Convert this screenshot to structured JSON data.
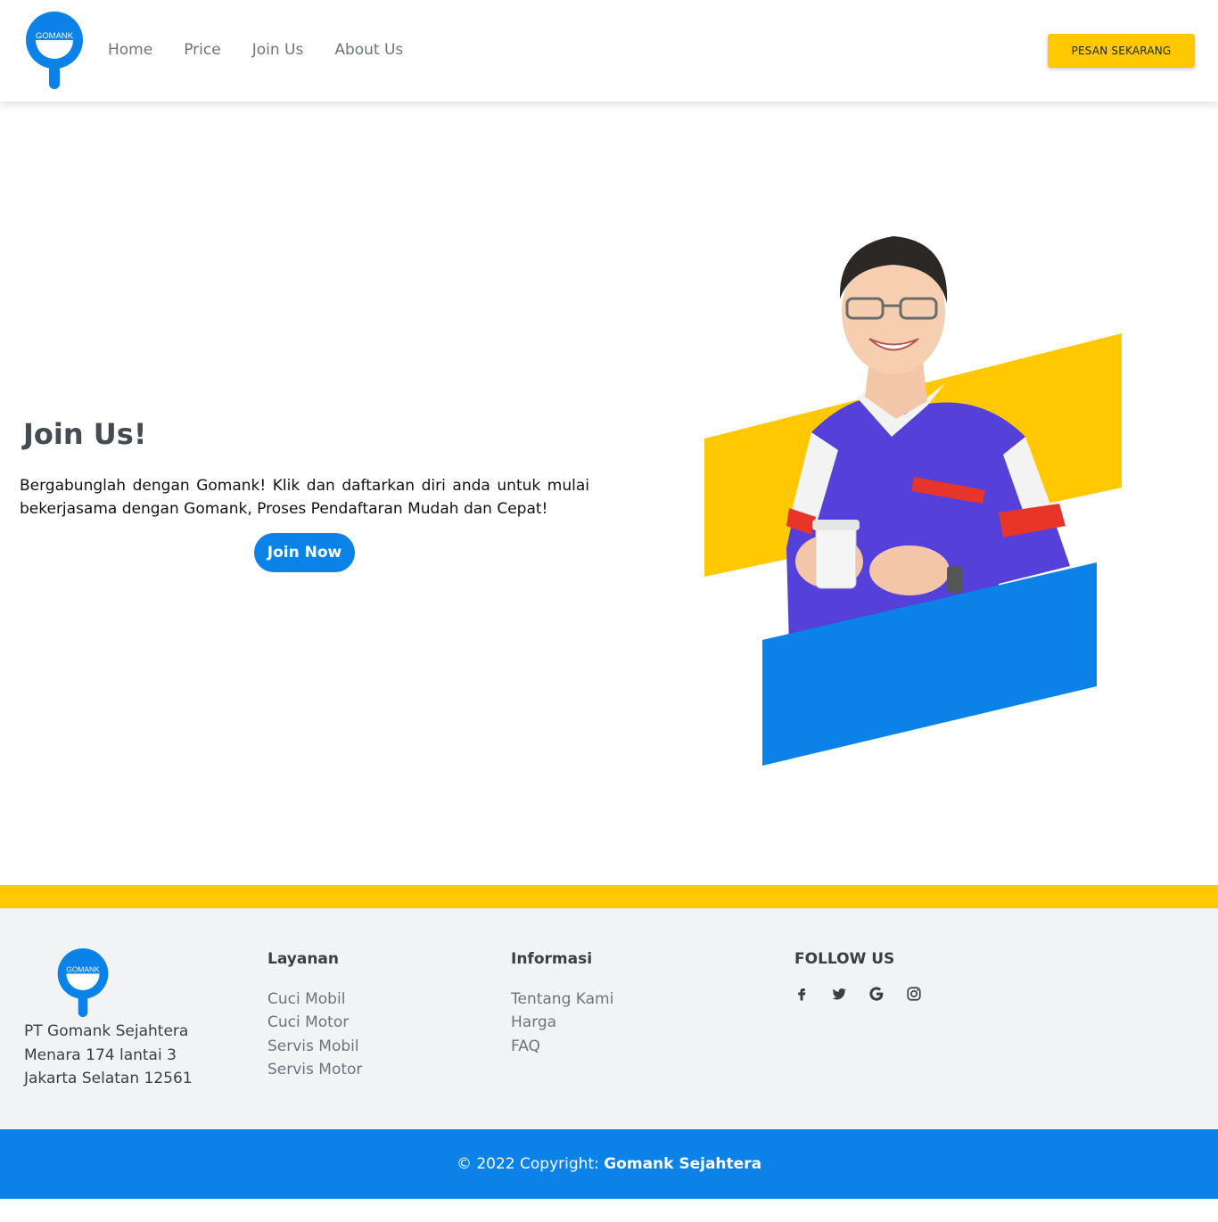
{
  "brand": {
    "logo_text": "GOMANK",
    "primary_color": "#0a82e8",
    "accent_color": "#ffc800"
  },
  "nav": {
    "links": [
      "Home",
      "Price",
      "Join Us",
      "About Us"
    ],
    "cta_label": "PESAN SEKARANG"
  },
  "hero": {
    "title": "Join Us!",
    "description": "Bergabunglah dengan Gomank! Klik dan daftarkan diri anda untuk mulai bekerjasama dengan Gomank, Proses Pendaftaran Mudah dan Cepat!",
    "button_label": "Join Now"
  },
  "footer": {
    "address_lines": [
      "PT Gomank Sejahtera",
      "Menara 174 lantai 3",
      "Jakarta Selatan 12561"
    ],
    "services": {
      "title": "Layanan",
      "items": [
        "Cuci Mobil",
        "Cuci Motor",
        "Servis Mobil",
        "Servis Motor"
      ]
    },
    "info": {
      "title": "Informasi",
      "items": [
        "Tentang Kami",
        "Harga",
        "FAQ"
      ]
    },
    "follow": {
      "title": "FOLLOW US",
      "icons": [
        "facebook-icon",
        "twitter-icon",
        "google-icon",
        "instagram-icon"
      ]
    },
    "copyright_prefix": "© 2022 Copyright: ",
    "copyright_name": "Gomank Sejahtera"
  }
}
